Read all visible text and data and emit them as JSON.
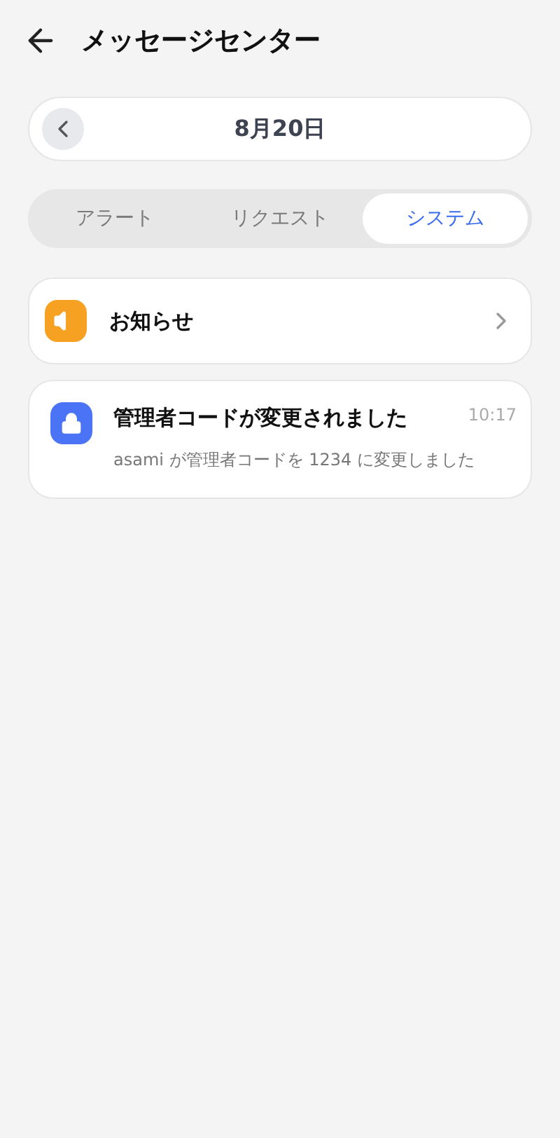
{
  "header": {
    "title": "メッセージセンター"
  },
  "date_bar": {
    "date": "8月20日"
  },
  "tabs": [
    {
      "label": "アラート",
      "selected": false
    },
    {
      "label": "リクエスト",
      "selected": false
    },
    {
      "label": "システム",
      "selected": true
    }
  ],
  "items": [
    {
      "kind": "link",
      "title": "お知らせ"
    },
    {
      "kind": "message",
      "title": "管理者コードが変更されました",
      "time": "10:17",
      "body": "asami が管理者コードを 1234 に変更しました"
    }
  ]
}
